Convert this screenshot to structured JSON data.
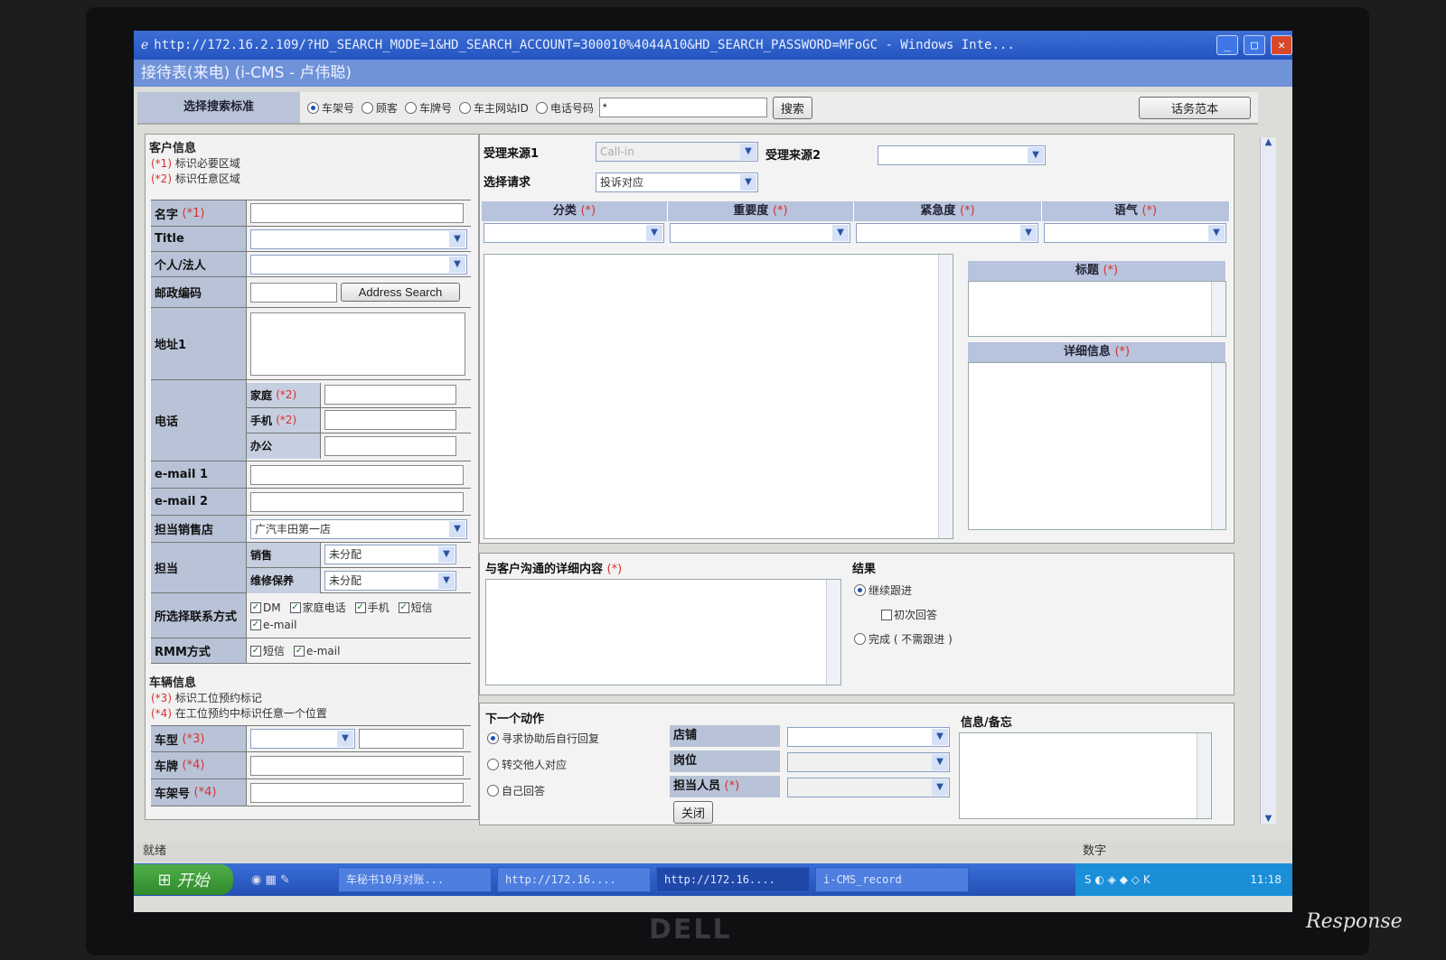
{
  "window": {
    "title": "http://172.16.2.109/?HD_SEARCH_MODE=1&HD_SEARCH_ACCOUNT=300010%4044A10&HD_SEARCH_PASSWORD=MFoGC - Windows Inte...",
    "app_title": "接待表(来电) (i-CMS - 卢伟聪)"
  },
  "search": {
    "label": "选择搜索标准",
    "options": [
      "车架号",
      "顾客",
      "车牌号",
      "车主网站ID",
      "电话号码"
    ],
    "selected": "车架号",
    "input_value": "*",
    "search_button": "搜索",
    "script_button": "话务范本"
  },
  "customer": {
    "header": "客户信息",
    "note1_mark": "(*1)",
    "note1": "标识必要区域",
    "note2_mark": "(*2)",
    "note2": "标识任意区域",
    "name_label": "名字",
    "name_mark": "(*1)",
    "title_label": "Title",
    "person_label": "个人/法人",
    "postal_label": "邮政编码",
    "address_search": "Address Search",
    "address_label": "地址1",
    "phone_label": "电话",
    "home_label": "家庭",
    "home_mark": "(*2)",
    "mobile_label": "手机",
    "mobile_mark": "(*2)",
    "office_label": "办公",
    "email1_label": "e-mail 1",
    "email2_label": "e-mail 2",
    "store_label": "担当销售店",
    "store_value": "广汽丰田第一店",
    "owner_label": "担当",
    "sales_label": "销售",
    "sales_value": "未分配",
    "service_label": "维修保养",
    "service_value": "未分配",
    "contact_label": "所选择联系方式",
    "contact_options": [
      "DM",
      "家庭电话",
      "手机",
      "短信",
      "e-mail"
    ],
    "rmm_label": "RMM方式",
    "rmm_options": [
      "短信",
      "e-mail"
    ]
  },
  "vehicle": {
    "header": "车辆信息",
    "note3_mark": "(*3)",
    "note3": "标识工位预约标记",
    "note4_mark": "(*4)",
    "note4": "在工位预约中标识任意一个位置",
    "model_label": "车型",
    "model_mark": "(*3)",
    "plate_label": "车牌",
    "plate_mark": "(*4)",
    "vin_label": "车架号",
    "vin_mark": "(*4)"
  },
  "inquiry": {
    "source1_label": "受理来源1",
    "source1_value": "Call-in",
    "source2_label": "受理来源2",
    "request_label": "选择请求",
    "request_value": "投诉对应",
    "columns": [
      {
        "label": "分类",
        "mark": "(*)"
      },
      {
        "label": "重要度",
        "mark": "(*)"
      },
      {
        "label": "紧急度",
        "mark": "(*)"
      },
      {
        "label": "语气",
        "mark": "(*)"
      }
    ],
    "subject_label": "标题",
    "subject_mark": "(*)",
    "detail_label": "详细信息",
    "detail_mark": "(*)"
  },
  "communication": {
    "label": "与客户沟通的详细内容",
    "mark": "(*)",
    "result_label": "结果",
    "result_options": [
      "继续跟进",
      "初次回答",
      "完成 ( 不需跟进 )"
    ]
  },
  "next_action": {
    "label": "下一个动作",
    "options": [
      "寻求协助后自行回复",
      "转交他人对应",
      "自己回答"
    ],
    "store_label": "店铺",
    "position_label": "岗位",
    "person_label": "担当人员",
    "person_mark": "(*)",
    "memo_label": "信息/备忘",
    "close_button": "关闭"
  },
  "status": {
    "text": "就绪",
    "mode": "数字"
  },
  "taskbar": {
    "start": "开始",
    "tasks": [
      "车秘书10月对账...",
      "http://172.16....",
      "http://172.16....",
      "i-CMS_record"
    ],
    "clock": "11:18"
  },
  "monitor_brand": "DELL",
  "watermark": "Response",
  "colors": {
    "titlebar": "#2a5ac6",
    "label_bg": "#b8c3d7",
    "required_mark": "#d83030"
  }
}
